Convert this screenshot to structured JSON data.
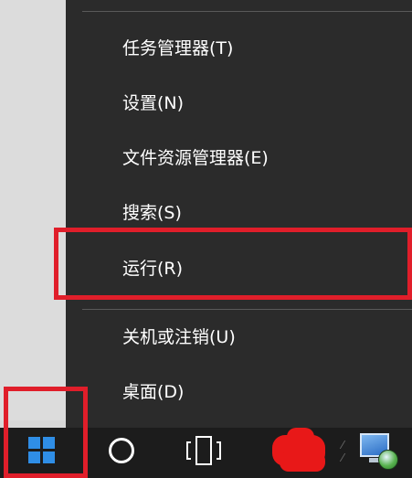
{
  "menu": {
    "items": [
      {
        "id": "task-manager",
        "label": "任务管理器(T)"
      },
      {
        "id": "settings",
        "label": "设置(N)"
      },
      {
        "id": "file-explorer",
        "label": "文件资源管理器(E)"
      },
      {
        "id": "search",
        "label": "搜索(S)"
      },
      {
        "id": "run",
        "label": "运行(R)"
      },
      {
        "id": "shutdown",
        "label": "关机或注销(U)"
      },
      {
        "id": "desktop",
        "label": "桌面(D)"
      }
    ],
    "highlighted_item": "run"
  },
  "taskbar": {
    "icons": [
      "windows-logo-icon",
      "cortana-circle-icon",
      "task-view-icon",
      "redacted-app-icon",
      "network-icon"
    ],
    "highlighted_icon": "windows-logo-icon"
  },
  "colors": {
    "menu_bg": "#2b2b2b",
    "menu_text": "#ffffff",
    "highlight_border": "#e01e2a",
    "taskbar_bg": "#1c1c1c",
    "windows_logo": "#2f8ee6"
  }
}
